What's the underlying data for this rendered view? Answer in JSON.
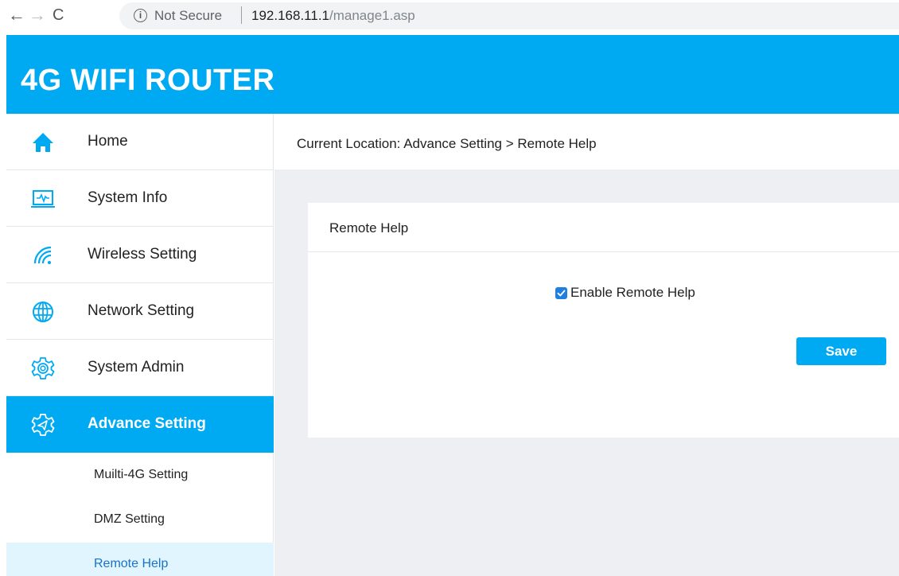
{
  "browser": {
    "back_glyph": "←",
    "forward_glyph": "→",
    "reload_glyph": "C",
    "info_glyph": "i",
    "security_label": "Not Secure",
    "url_host": "192.168.11.1",
    "url_path": "/manage1.asp"
  },
  "header": {
    "title": "4G WIFI ROUTER"
  },
  "sidebar": {
    "items": [
      {
        "label": "Home",
        "icon": "home-icon"
      },
      {
        "label": "System Info",
        "icon": "monitor-icon"
      },
      {
        "label": "Wireless Setting",
        "icon": "wifi-icon"
      },
      {
        "label": "Network Setting",
        "icon": "globe-icon"
      },
      {
        "label": "System Admin",
        "icon": "gear-icon"
      },
      {
        "label": "Advance Setting",
        "icon": "advanced-gear-icon",
        "active": true
      }
    ],
    "subitems": [
      {
        "label": "Muilti-4G Setting"
      },
      {
        "label": "DMZ Setting"
      },
      {
        "label": "Remote Help",
        "current": true
      }
    ]
  },
  "main": {
    "location": "Current Location:  Advance Setting > Remote Help",
    "panel": {
      "title": "Remote Help",
      "checkbox_label": "Enable Remote Help",
      "checkbox_checked": true,
      "save_label": "Save"
    }
  },
  "colors": {
    "accent": "#00aaf2",
    "checkbox": "#1f7fe0",
    "content_bg": "#eeeff3",
    "current_sub_bg": "#e0f5fd"
  }
}
